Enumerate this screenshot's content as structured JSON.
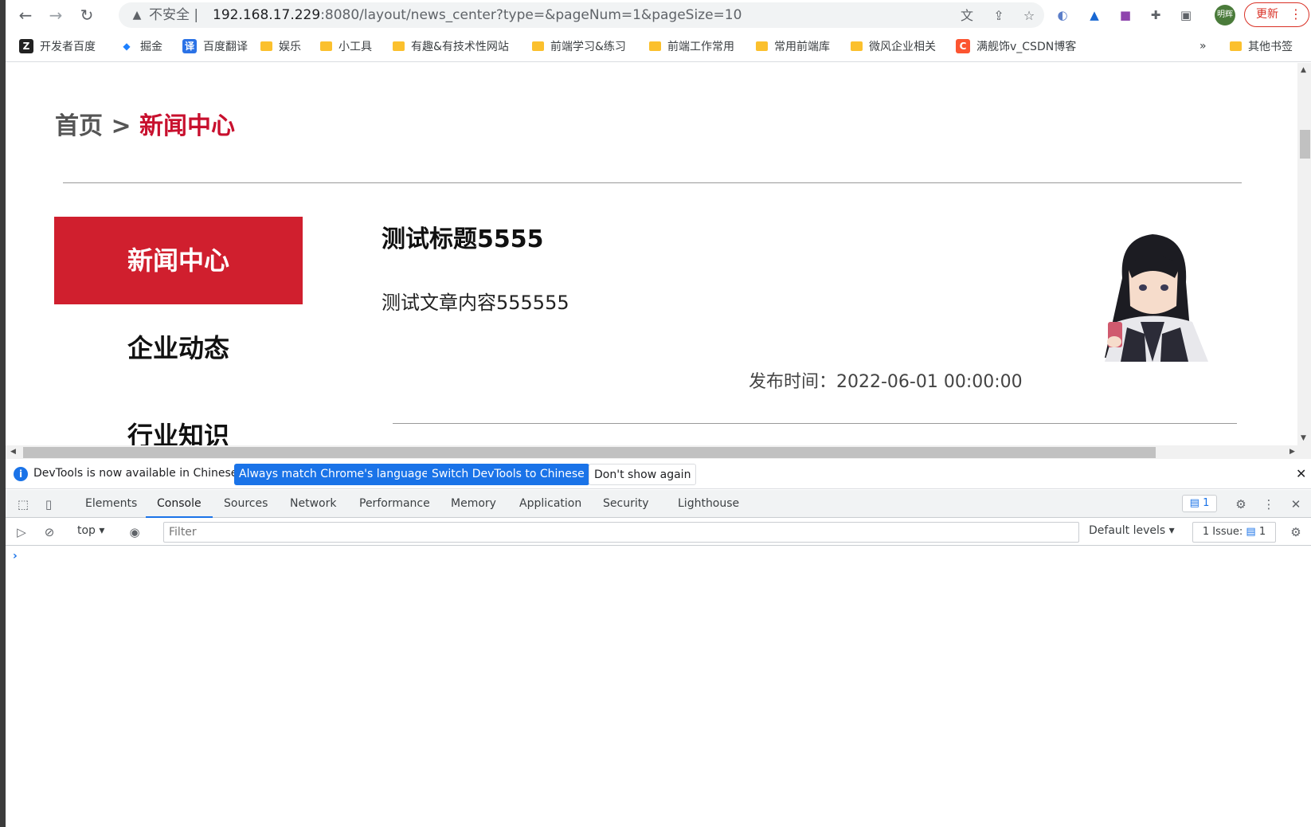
{
  "browser": {
    "insecure_label": "不安全",
    "url_host": "192.168.17.229",
    "url_rest": ":8080/layout/news_center?type=&pageNum=1&pageSize=10",
    "profile_initials": "明辉",
    "update_label": "更新"
  },
  "bookmarks": [
    {
      "label": "开发者百度",
      "icon": "Z"
    },
    {
      "label": "掘金",
      "icon": "juejin"
    },
    {
      "label": "百度翻译",
      "icon": "译"
    },
    {
      "label": "娱乐",
      "icon": "folder"
    },
    {
      "label": "小工具",
      "icon": "folder"
    },
    {
      "label": "有趣&有技术性网站",
      "icon": "folder"
    },
    {
      "label": "前端学习&练习",
      "icon": "folder"
    },
    {
      "label": "前端工作常用",
      "icon": "folder"
    },
    {
      "label": "常用前端库",
      "icon": "folder"
    },
    {
      "label": "微风企业相关",
      "icon": "folder"
    },
    {
      "label": "满舰饰v_CSDN博客",
      "icon": "C"
    },
    {
      "label": "其他书签",
      "icon": "folder"
    }
  ],
  "bookmarks_overflow": "»",
  "page": {
    "breadcrumb_home": "首页",
    "breadcrumb_sep": ">",
    "breadcrumb_current": "新闻中心",
    "sidebar": [
      "新闻中心",
      "企业动态",
      "行业知识"
    ],
    "news": {
      "title": "测试标题5555",
      "content": "测试文章内容555555",
      "time": "发布时间：2022-06-01 00:00:00"
    }
  },
  "devtools": {
    "info_text": "DevTools is now available in Chinese!",
    "btn_match": "Always match Chrome's language",
    "btn_switch": "Switch DevTools to Chinese",
    "btn_dismiss": "Don't show again",
    "tabs": [
      "Elements",
      "Console",
      "Sources",
      "Network",
      "Performance",
      "Memory",
      "Application",
      "Security",
      "Lighthouse"
    ],
    "active_tab": "Console",
    "messages_badge": "1",
    "context": "top",
    "filter_placeholder": "Filter",
    "levels": "Default levels",
    "issues_label": "1 Issue:",
    "issues_count": "1",
    "prompt": "›"
  },
  "colors": {
    "accent": "#d01f2e",
    "devtools_blue": "#1a73e8"
  }
}
